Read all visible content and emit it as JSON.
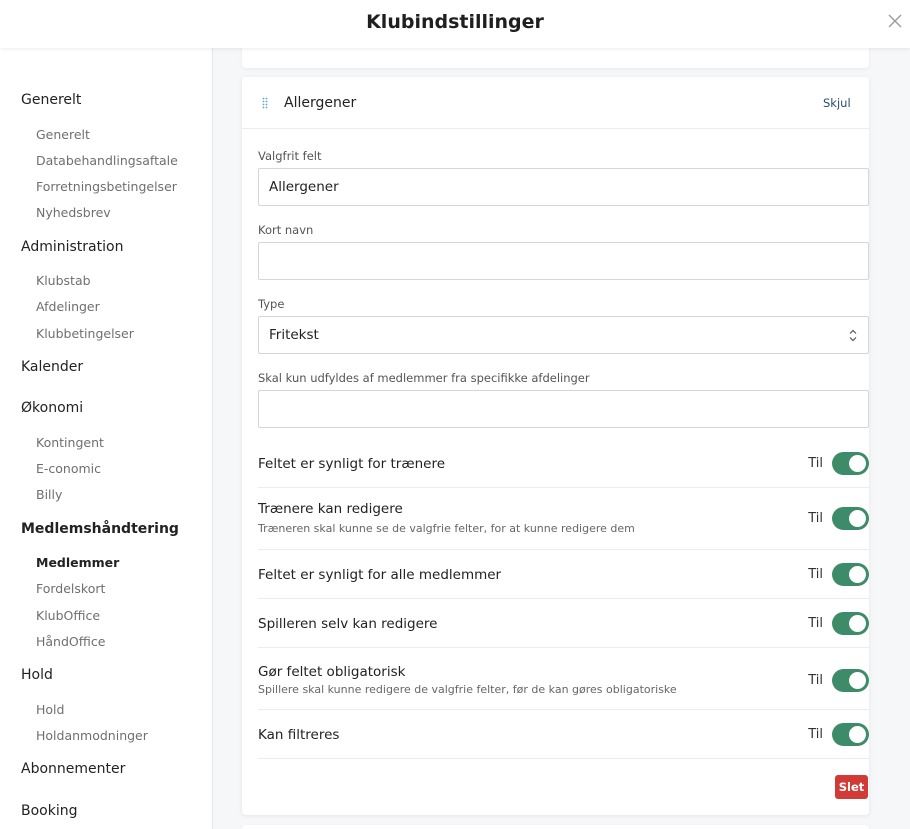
{
  "header": {
    "title": "Klubindstillinger",
    "close_icon": "close-icon"
  },
  "sidebar": {
    "groups": [
      {
        "label": "Generelt",
        "items": [
          "Generelt",
          "Databehandlingsaftale",
          "Forretningsbetingelser",
          "Nyhedsbrev"
        ]
      },
      {
        "label": "Administration",
        "items": [
          "Klubstab",
          "Afdelinger",
          "Klubbetingelser"
        ]
      },
      {
        "label": "Kalender",
        "items": []
      },
      {
        "label": "Økonomi",
        "items": [
          "Kontingent",
          "E-conomic",
          "Billy"
        ]
      },
      {
        "label": "Medlemshåndtering",
        "items": [
          "Medlemmer",
          "Fordelskort",
          "KlubOffice",
          "HåndOffice"
        ]
      },
      {
        "label": "Hold",
        "items": [
          "Hold",
          "Holdanmodninger"
        ]
      },
      {
        "label": "Abonnementer",
        "items": []
      },
      {
        "label": "Booking",
        "items": []
      }
    ],
    "active_group": "Medlemshåndtering",
    "active_item": "Medlemmer"
  },
  "card": {
    "title": "Allergener",
    "hide_label": "Skjul",
    "fields": {
      "valgfrit_label": "Valgfrit felt",
      "valgfrit_value": "Allergener",
      "kort_label": "Kort navn",
      "kort_value": "",
      "type_label": "Type",
      "type_value": "Fritekst",
      "afdelinger_label": "Skal kun udfyldes af medlemmer fra specifikke afdelinger",
      "afdelinger_value": ""
    },
    "toggles": [
      {
        "label": "Feltet er synligt for trænere",
        "sub": "",
        "state": "Til"
      },
      {
        "label": "Trænere kan redigere",
        "sub": "Træneren skal kunne se de valgfrie felter, for at kunne redigere dem",
        "state": "Til"
      },
      {
        "label": "Feltet er synligt for alle medlemmer",
        "sub": "",
        "state": "Til"
      },
      {
        "label": "Spilleren selv kan redigere",
        "sub": "",
        "state": "Til"
      },
      {
        "label": "Gør feltet obligatorisk",
        "sub": "Spillere skal kunne redigere de valgfrie felter, før de kan gøres obligatoriske",
        "state": "Til"
      },
      {
        "label": "Kan filtreres",
        "sub": "",
        "state": "Til"
      }
    ],
    "delete_label": "Slet"
  },
  "colors": {
    "toggle_on": "#3d8b68",
    "delete": "#d23a35",
    "link": "#2a4d6e"
  }
}
